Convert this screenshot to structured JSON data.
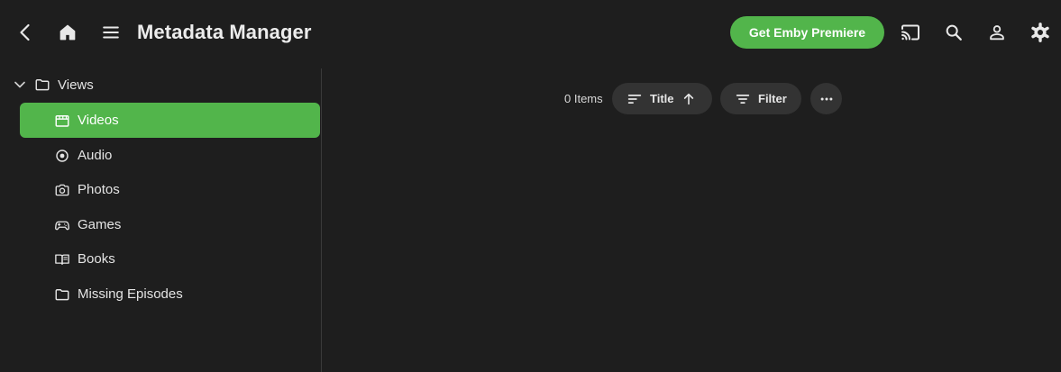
{
  "header": {
    "title": "Metadata Manager",
    "premiere_label": "Get Emby Premiere",
    "icons": [
      "back-arrow-icon",
      "home-icon",
      "menu-icon",
      "cast-icon",
      "search-icon",
      "user-icon",
      "settings-gear-icon"
    ]
  },
  "sidebar": {
    "root": {
      "label": "Views",
      "icon": "folder-icon",
      "expanded": true
    },
    "items": [
      {
        "label": "Videos",
        "icon": "video-clapper-icon",
        "active": true
      },
      {
        "label": "Audio",
        "icon": "disc-icon",
        "active": false
      },
      {
        "label": "Photos",
        "icon": "camera-icon",
        "active": false
      },
      {
        "label": "Games",
        "icon": "gamepad-icon",
        "active": false
      },
      {
        "label": "Books",
        "icon": "book-icon",
        "active": false
      },
      {
        "label": "Missing Episodes",
        "icon": "folder-icon",
        "active": false
      }
    ]
  },
  "toolbar": {
    "items_count": "0 Items",
    "sort_label": "Title",
    "filter_label": "Filter",
    "more_icon": "more-horizontal-icon"
  },
  "colors": {
    "accent": "#52b54b",
    "background": "#1e1e1e",
    "pill": "#333333"
  }
}
